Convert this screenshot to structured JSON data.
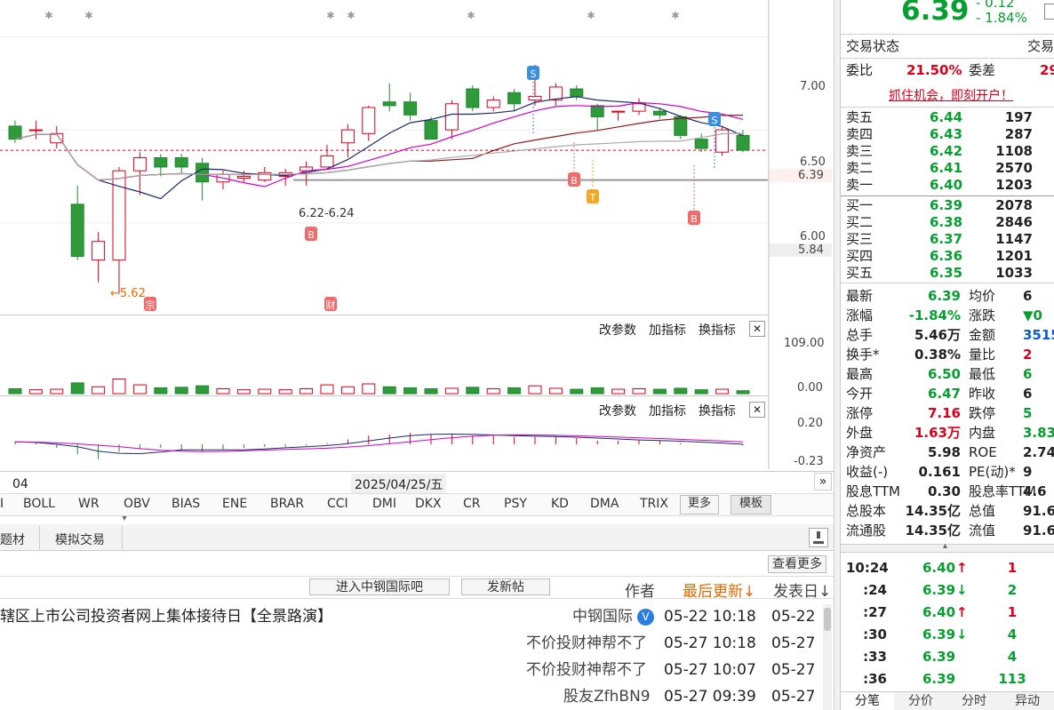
{
  "chart": {
    "price_ticks": [
      "7.00",
      "6.50",
      "6.00"
    ],
    "current_price_label": "6.39",
    "gray_label": "5.84",
    "low_label": "←5.62",
    "range_label": "6.22-6.24",
    "markers": {
      "s": "S",
      "b": "B",
      "t": "T",
      "zong": "宗",
      "cai": "财"
    },
    "vol_panel": {
      "ticks": [
        "109.00",
        "0.00"
      ],
      "buttons": [
        "改参数",
        "加指标",
        "换指标"
      ]
    },
    "macd_panel": {
      "ticks": [
        "0.20",
        "-0.23"
      ],
      "buttons": [
        "改参数",
        "加指标",
        "换指标"
      ]
    },
    "x_labels": [
      "04",
      "2025/04/25/五"
    ],
    "close_glyph": "✕",
    "expand_glyph": "»"
  },
  "chart_data": {
    "type": "candlestick",
    "ylim": [
      5.55,
      7.15
    ],
    "candles": [
      {
        "o": 6.52,
        "c": 6.45,
        "h": 6.55,
        "l": 6.43
      },
      {
        "o": 6.5,
        "c": 6.5,
        "h": 6.55,
        "l": 6.45
      },
      {
        "o": 6.43,
        "c": 6.48,
        "h": 6.52,
        "l": 6.4
      },
      {
        "o": 6.1,
        "c": 5.82,
        "h": 6.2,
        "l": 5.8
      },
      {
        "o": 5.8,
        "c": 5.9,
        "h": 5.95,
        "l": 5.68
      },
      {
        "o": 5.8,
        "c": 6.28,
        "h": 6.3,
        "l": 5.62
      },
      {
        "o": 6.28,
        "c": 6.35,
        "h": 6.38,
        "l": 6.15
      },
      {
        "o": 6.35,
        "c": 6.3,
        "h": 6.37,
        "l": 6.25
      },
      {
        "o": 6.35,
        "c": 6.3,
        "h": 6.37,
        "l": 6.27
      },
      {
        "o": 6.32,
        "c": 6.22,
        "h": 6.35,
        "l": 6.12
      },
      {
        "o": 6.22,
        "c": 6.26,
        "h": 6.28,
        "l": 6.18
      },
      {
        "o": 6.24,
        "c": 6.25,
        "h": 6.28,
        "l": 6.22
      },
      {
        "o": 6.23,
        "c": 6.27,
        "h": 6.3,
        "l": 6.22
      },
      {
        "o": 6.25,
        "c": 6.27,
        "h": 6.29,
        "l": 6.2
      },
      {
        "o": 6.28,
        "c": 6.3,
        "h": 6.33,
        "l": 6.2
      },
      {
        "o": 6.3,
        "c": 6.36,
        "h": 6.42,
        "l": 6.3
      },
      {
        "o": 6.43,
        "c": 6.5,
        "h": 6.53,
        "l": 6.35
      },
      {
        "o": 6.48,
        "c": 6.62,
        "h": 6.63,
        "l": 6.44
      },
      {
        "o": 6.65,
        "c": 6.63,
        "h": 6.75,
        "l": 6.6
      },
      {
        "o": 6.65,
        "c": 6.58,
        "h": 6.7,
        "l": 6.55
      },
      {
        "o": 6.55,
        "c": 6.45,
        "h": 6.57,
        "l": 6.45
      },
      {
        "o": 6.5,
        "c": 6.64,
        "h": 6.66,
        "l": 6.45
      },
      {
        "o": 6.72,
        "c": 6.62,
        "h": 6.74,
        "l": 6.6
      },
      {
        "o": 6.62,
        "c": 6.66,
        "h": 6.68,
        "l": 6.6
      },
      {
        "o": 6.7,
        "c": 6.64,
        "h": 6.72,
        "l": 6.6
      },
      {
        "o": 6.66,
        "c": 6.68,
        "h": 6.85,
        "l": 6.63
      },
      {
        "o": 6.66,
        "c": 6.73,
        "h": 6.75,
        "l": 6.63
      },
      {
        "o": 6.72,
        "c": 6.68,
        "h": 6.74,
        "l": 6.66
      },
      {
        "o": 6.63,
        "c": 6.57,
        "h": 6.64,
        "l": 6.5
      },
      {
        "o": 6.6,
        "c": 6.6,
        "h": 6.6,
        "l": 6.55
      },
      {
        "o": 6.6,
        "c": 6.64,
        "h": 6.67,
        "l": 6.58
      },
      {
        "o": 6.6,
        "c": 6.58,
        "h": 6.62,
        "l": 6.56
      },
      {
        "o": 6.57,
        "c": 6.47,
        "h": 6.58,
        "l": 6.45
      },
      {
        "o": 6.45,
        "c": 6.4,
        "h": 6.48,
        "l": 6.38
      },
      {
        "o": 6.38,
        "c": 6.5,
        "h": 6.52,
        "l": 6.36
      },
      {
        "o": 6.47,
        "c": 6.39,
        "h": 6.5,
        "l": 6.38
      }
    ],
    "volumes": [
      10,
      8,
      9,
      22,
      14,
      30,
      18,
      12,
      13,
      16,
      10,
      8,
      9,
      8,
      10,
      18,
      14,
      20,
      14,
      12,
      10,
      11,
      13,
      10,
      12,
      16,
      11,
      9,
      12,
      9,
      10,
      9,
      11,
      8,
      9,
      6
    ],
    "macd": [
      0.02,
      0.01,
      -0.03,
      -0.08,
      -0.12,
      -0.06,
      -0.04,
      -0.03,
      -0.05,
      -0.06,
      -0.04,
      -0.03,
      -0.02,
      -0.02,
      -0.01,
      0.01,
      0.04,
      0.07,
      0.08,
      0.09,
      0.08,
      0.08,
      0.07,
      0.07,
      0.06,
      0.06,
      0.06,
      0.05,
      0.03,
      0.03,
      0.03,
      0.03,
      0.01,
      0.0,
      0.0,
      -0.01
    ]
  },
  "indicators": [
    "I",
    "BOLL",
    "WR",
    "OBV",
    "BIAS",
    "ENE",
    "BRAR",
    "CCI",
    "DMI",
    "DKX",
    "CR",
    "PSY",
    "KD",
    "DMA",
    "TRIX"
  ],
  "more_btn": "更多",
  "template_btn": "模板",
  "tabs": [
    "题材",
    "模拟交易"
  ],
  "view_more": "查看更多",
  "forum": {
    "enter": "进入中钢国际吧",
    "post": "发新帖",
    "author": "作者",
    "last_update": "最后更新↓",
    "post_date": "发表日↓"
  },
  "topics": [
    {
      "title": "辖区上市公司投资者网上集体接待日【全景路演】",
      "author": "中钢国际",
      "verified": "V",
      "updated": "05-22 10:18",
      "posted": "05-22"
    },
    {
      "title": "",
      "author": "不价投财神帮不了",
      "verified": "",
      "updated": "05-27 10:18",
      "posted": "05-27"
    },
    {
      "title": "",
      "author": "不价投财神帮不了",
      "verified": "",
      "updated": "05-27 10:07",
      "posted": "05-27"
    },
    {
      "title": "",
      "author": "股友ZfhBN9",
      "verified": "",
      "updated": "05-27 09:39",
      "posted": "05-27"
    }
  ],
  "quote": {
    "price": "6.39",
    "change": "- 0.12",
    "pct": "- 1.84%",
    "status_label": "交易状态",
    "status_label2": "交易",
    "weibi_label": "委比",
    "weibi": "21.50%",
    "weicha_label": "委差",
    "weicha": "29",
    "ad": "抓住机会，即刻开户！",
    "sells": [
      {
        "l": "卖五",
        "p": "6.44",
        "v": "197"
      },
      {
        "l": "卖四",
        "p": "6.43",
        "v": "287"
      },
      {
        "l": "卖三",
        "p": "6.42",
        "v": "1108"
      },
      {
        "l": "卖二",
        "p": "6.41",
        "v": "2570"
      },
      {
        "l": "卖一",
        "p": "6.40",
        "v": "1203"
      }
    ],
    "buys": [
      {
        "l": "买一",
        "p": "6.39",
        "v": "2078"
      },
      {
        "l": "买二",
        "p": "6.38",
        "v": "2846"
      },
      {
        "l": "买三",
        "p": "6.37",
        "v": "1147"
      },
      {
        "l": "买四",
        "p": "6.36",
        "v": "1201"
      },
      {
        "l": "买五",
        "p": "6.35",
        "v": "1033"
      }
    ],
    "stats": [
      {
        "a": "最新",
        "av": "6.39",
        "ac": "green",
        "b": "均价",
        "bv": "6",
        "bc": "blk"
      },
      {
        "a": "涨幅",
        "av": "-1.84%",
        "ac": "green",
        "b": "涨跌",
        "bv": "▼0",
        "bc": "green"
      },
      {
        "a": "总手",
        "av": "5.46万",
        "ac": "blk",
        "b": "金额",
        "bv": "3515",
        "bc": "blue"
      },
      {
        "a": "换手*",
        "av": "0.38%",
        "ac": "blk",
        "b": "量比",
        "bv": "2",
        "bc": "red"
      },
      {
        "a": "最高",
        "av": "6.50",
        "ac": "green",
        "b": "最低",
        "bv": "6",
        "bc": "green"
      },
      {
        "a": "今开",
        "av": "6.47",
        "ac": "green",
        "b": "昨收",
        "bv": "6",
        "bc": "blk"
      },
      {
        "a": "涨停",
        "av": "7.16",
        "ac": "red",
        "b": "跌停",
        "bv": "5",
        "bc": "green"
      },
      {
        "a": "外盘",
        "av": "1.63万",
        "ac": "red",
        "b": "内盘",
        "bv": "3.83",
        "bc": "green"
      },
      {
        "a": "净资产",
        "av": "5.98",
        "ac": "blk",
        "b": "ROE",
        "bv": "2.74",
        "bc": "blk"
      },
      {
        "a": "收益(-)",
        "av": "0.161",
        "ac": "blk",
        "b": "PE(动)*",
        "bv": "9",
        "bc": "blk"
      },
      {
        "a": "股息TTM",
        "av": "0.30",
        "ac": "blk",
        "b": "股息率TTM",
        "bv": "4.6",
        "bc": "blk"
      },
      {
        "a": "总股本",
        "av": "14.35亿",
        "ac": "blk",
        "b": "总值",
        "bv": "91.67",
        "bc": "blk"
      },
      {
        "a": "流通股",
        "av": "14.35亿",
        "ac": "blk",
        "b": "流值",
        "bv": "91.67",
        "bc": "blk"
      }
    ],
    "ticks": [
      {
        "t": "10:24",
        "p": "6.40",
        "a": "↑",
        "ac": "red",
        "v": "1",
        "vc": "red"
      },
      {
        "t": ":24",
        "p": "6.39",
        "a": "↓",
        "ac": "green",
        "v": "2",
        "vc": "green"
      },
      {
        "t": ":27",
        "p": "6.40",
        "a": "↑",
        "ac": "red",
        "v": "1",
        "vc": "red"
      },
      {
        "t": ":30",
        "p": "6.39",
        "a": "↓",
        "ac": "green",
        "v": "4",
        "vc": "green"
      },
      {
        "t": ":33",
        "p": "6.39",
        "a": "",
        "ac": "green",
        "v": "4",
        "vc": "green"
      },
      {
        "t": ":36",
        "p": "6.39",
        "a": "",
        "ac": "green",
        "v": "113",
        "vc": "green"
      }
    ],
    "bottom_tabs": [
      "分笔",
      "分价",
      "分时",
      "异动"
    ]
  }
}
